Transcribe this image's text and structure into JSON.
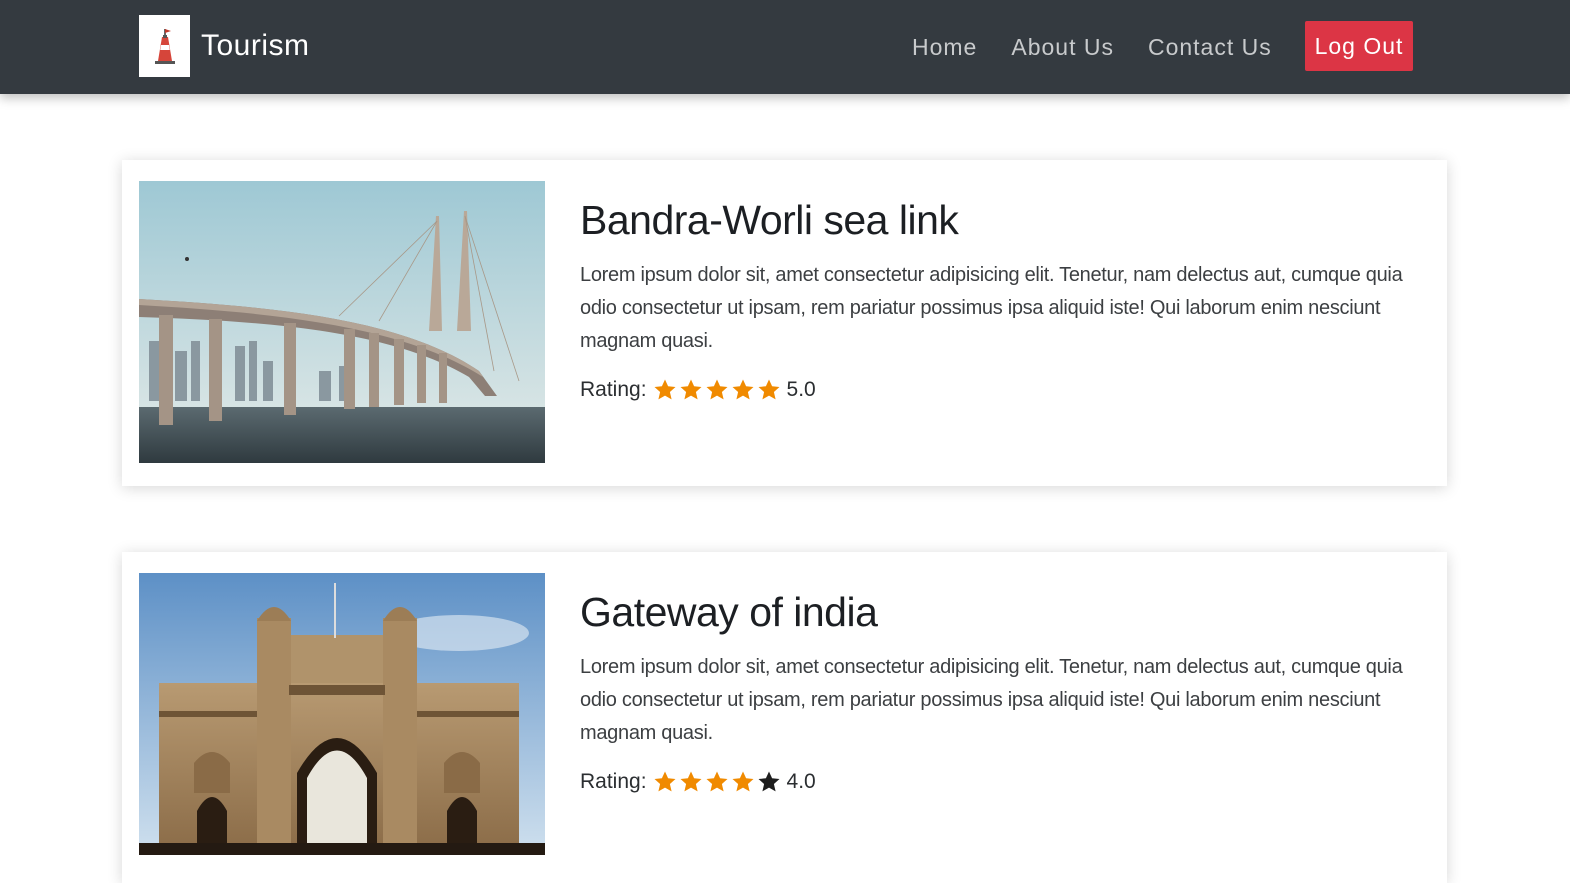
{
  "brand": {
    "name": "Tourism",
    "logo_icon": "lighthouse-icon"
  },
  "nav": {
    "links": [
      "Home",
      "About Us",
      "Contact Us"
    ],
    "logout_label": "Log Out"
  },
  "colors": {
    "navbar": "#343a40",
    "logout": "#dc3545",
    "star_on": "#f08a00",
    "star_off": "#1e1e1e"
  },
  "places": [
    {
      "title": "Bandra-Worli sea link",
      "description": "Lorem ipsum dolor sit, amet consectetur adipisicing elit. Tenetur, nam delectus aut, cumque quia odio consectetur ut ipsam, rem pariatur possimus ipsa aliquid iste! Qui laborum enim nesciunt magnam quasi.",
      "rating_label": "Rating:",
      "stars": 5,
      "rating_value": "5.0",
      "image_icon": "sea-link-bridge-photo"
    },
    {
      "title": "Gateway of india",
      "description": "Lorem ipsum dolor sit, amet consectetur adipisicing elit. Tenetur, nam delectus aut, cumque quia odio consectetur ut ipsam, rem pariatur possimus ipsa aliquid iste! Qui laborum enim nesciunt magnam quasi.",
      "rating_label": "Rating:",
      "stars": 4,
      "rating_value": "4.0",
      "image_icon": "gateway-monument-photo"
    }
  ]
}
